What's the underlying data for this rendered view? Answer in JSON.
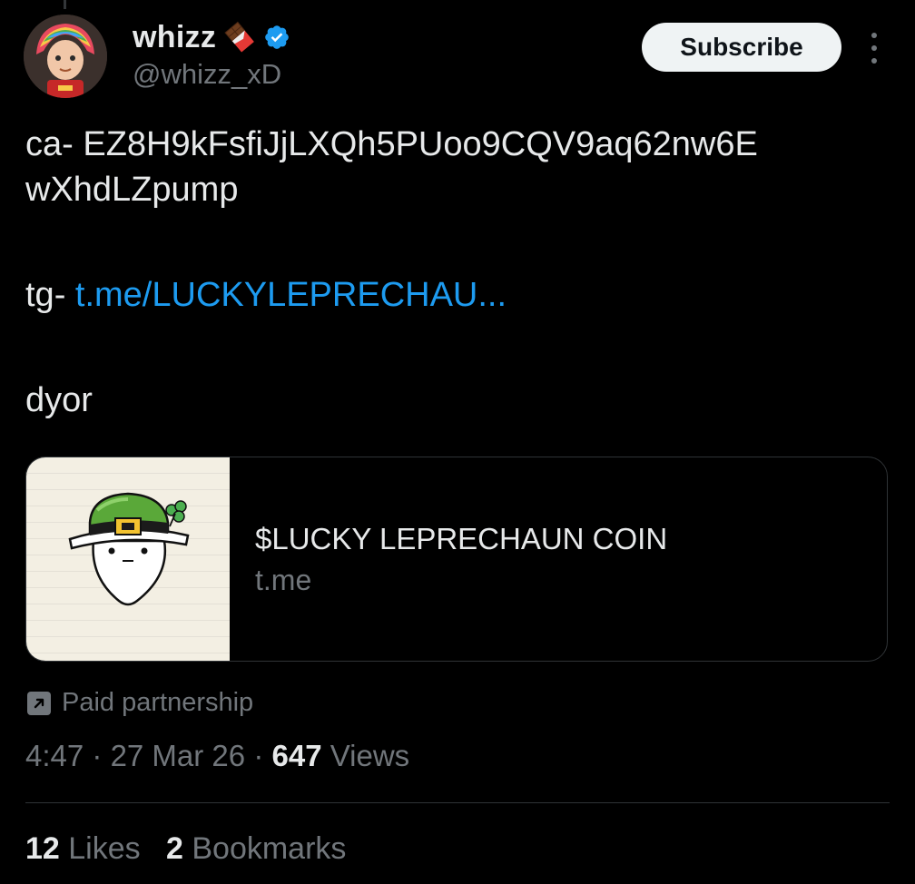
{
  "author": {
    "display_name": "whizz",
    "handle": "@whizz_xD",
    "emoji": "chocolate-bar",
    "verified": true,
    "verified_color": "#1d9bf0"
  },
  "header": {
    "subscribe_label": "Subscribe",
    "more_icon": "more-vertical-icon"
  },
  "tweet": {
    "ca_line1": "ca-  EZ8H9kFsfiJjLXQh5PUoo9CQV9aq62nw6E",
    "ca_line2": "wXhdLZpump",
    "tg_prefix": "tg- ",
    "tg_link": "t.me/LUCKYLEPRECHAU...",
    "dyor": "dyor",
    "link_color": "#1d9bf0"
  },
  "card": {
    "title": "$LUCKY LEPRECHAUN COIN",
    "domain": "t.me"
  },
  "paid_partnership": {
    "label": "Paid partnership",
    "icon": "arrow-up-right-icon"
  },
  "meta": {
    "time": "4:47",
    "sep1": " · ",
    "date": "27 Mar 26",
    "sep2": " · ",
    "views_count": "647",
    "views_label": " Views"
  },
  "stats": {
    "likes_count": "12",
    "likes_label": " Likes",
    "bookmarks_count": "2",
    "bookmarks_label": " Bookmarks"
  }
}
